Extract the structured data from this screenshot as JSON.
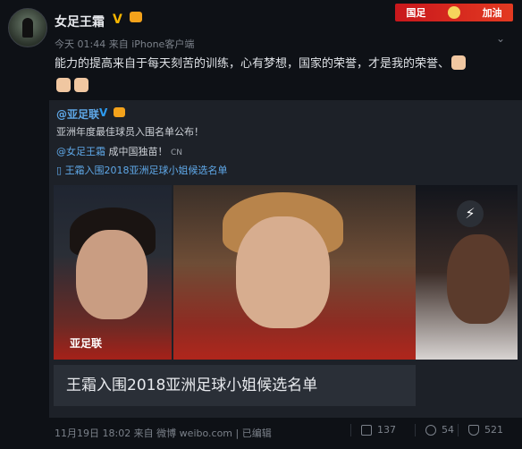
{
  "post": {
    "author": "女足王霜",
    "verified_mark": "V",
    "meta": "今天 01:44 来自 iPhone客户端",
    "banner": {
      "left": "国足",
      "right": "加油"
    },
    "content": "能力的提高来自于每天刻苦的训练，心有梦想，国家的荣誉，才是我的荣誉、"
  },
  "repost": {
    "author": "@亚足联",
    "verified_mark": "V",
    "line1": "亚洲年度最佳球员入围名单公布！",
    "mention": "@女足王霜",
    "line2": "成中国独苗！",
    "cn_tag": "CN",
    "link": "王霜入围2018亚洲足球小姐候选名单",
    "watermark": "亚足联",
    "card_title": "王霜入围2018亚洲足球小姐候选名单"
  },
  "footer": {
    "time": "11月19日 18:02 来自 微博 weibo.com",
    "edited": "已编辑",
    "reposts": "137",
    "comments": "54",
    "likes": "521"
  },
  "icons": [
    "avatar",
    "verified-icon",
    "crown-icon",
    "banner-icon",
    "chevron-down-icon",
    "fist-emoji-icon",
    "link-icon",
    "lightning-icon",
    "repost-icon",
    "comment-icon",
    "like-icon"
  ]
}
